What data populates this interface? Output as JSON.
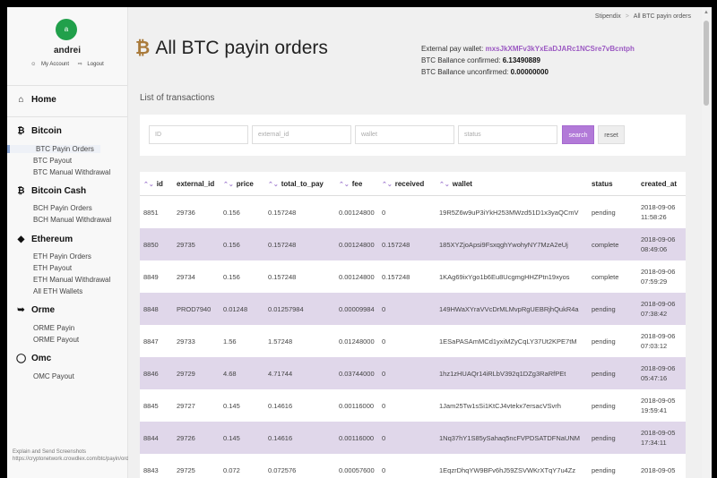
{
  "user": {
    "initial": "a",
    "name": "andrei",
    "my_account": "My Account",
    "logout": "Logout"
  },
  "sidebar": {
    "home": "Home",
    "bitcoin": {
      "title": "Bitcoin",
      "items": [
        "BTC Payin Orders",
        "BTC Payout",
        "BTC Manual Withdrawal"
      ]
    },
    "bitcoin_cash": {
      "title": "Bitcoin Cash",
      "items": [
        "BCH Payin Orders",
        "BCH Manual Withdrawal"
      ]
    },
    "ethereum": {
      "title": "Ethereum",
      "items": [
        "ETH Payin Orders",
        "ETH Payout",
        "ETH Manual Withdrawal",
        "All ETH Wallets"
      ]
    },
    "orme": {
      "title": "Orme",
      "items": [
        "ORME Payin",
        "ORME Payout"
      ]
    },
    "omc": {
      "title": "Omc",
      "items": [
        "OMC Payout"
      ]
    }
  },
  "footer": {
    "explain": "Explain and Send Screenshots",
    "url": "https://cryptonetwork.crowdlex.com/btc/payin/orders"
  },
  "breadcrumb": {
    "root": "Stipendix",
    "current": "All BTC payin orders"
  },
  "page": {
    "title": "All BTC payin orders"
  },
  "info": {
    "wallet_label": "External pay wallet:",
    "wallet_address": "mxsJkXMFv3kYxEaDJARc1NCSre7vBcntph",
    "confirmed_label": "BTC Ballance confirmed:",
    "confirmed_value": "6.13490889",
    "unconfirmed_label": "BTC Ballance unconfirmed:",
    "unconfirmed_value": "0.00000000"
  },
  "filters": {
    "subtitle": "List of transactions",
    "id_placeholder": "ID",
    "external_id_placeholder": "external_id",
    "wallet_placeholder": "wallet",
    "status_placeholder": "status",
    "search_label": "search",
    "reset_label": "reset"
  },
  "table": {
    "headers": {
      "id": "id",
      "external_id": "external_id",
      "price": "price",
      "total_to_pay": "total_to_pay",
      "fee": "fee",
      "received": "received",
      "wallet": "wallet",
      "status": "status",
      "created_at": "created_at"
    },
    "rows": [
      {
        "id": "8851",
        "external_id": "29736",
        "price": "0.156",
        "total_to_pay": "0.157248",
        "fee": "0.00124800",
        "received": "0",
        "wallet": "19R5Z6w9uP3iYkH253MWzd51D1x3yaQCmV",
        "status": "pending",
        "date": "2018-09-06",
        "time": "11:58:26"
      },
      {
        "id": "8850",
        "external_id": "29735",
        "price": "0.156",
        "total_to_pay": "0.157248",
        "fee": "0.00124800",
        "received": "0.157248",
        "wallet": "185XYZjoApsi9FsxqghYwohyNY7MzA2eUj",
        "status": "complete",
        "date": "2018-09-06",
        "time": "08:49:06"
      },
      {
        "id": "8849",
        "external_id": "29734",
        "price": "0.156",
        "total_to_pay": "0.157248",
        "fee": "0.00124800",
        "received": "0.157248",
        "wallet": "1KAg69ixYgo1b6Eu8UcgmgHHZPtn19xyos",
        "status": "complete",
        "date": "2018-09-06",
        "time": "07:59:29"
      },
      {
        "id": "8848",
        "external_id": "PROD7940",
        "price": "0.01248",
        "total_to_pay": "0.01257984",
        "fee": "0.00009984",
        "received": "0",
        "wallet": "149HWaXYraVVcDrMLMvpRgUEBRjhQukR4a",
        "status": "pending",
        "date": "2018-09-06",
        "time": "07:38:42"
      },
      {
        "id": "8847",
        "external_id": "29733",
        "price": "1.56",
        "total_to_pay": "1.57248",
        "fee": "0.01248000",
        "received": "0",
        "wallet": "1ESaPASAmMCd1yxiMZyCqLY37Ut2KPE7tM",
        "status": "pending",
        "date": "2018-09-06",
        "time": "07:03:12"
      },
      {
        "id": "8846",
        "external_id": "29729",
        "price": "4.68",
        "total_to_pay": "4.71744",
        "fee": "0.03744000",
        "received": "0",
        "wallet": "1hz1zHUAQr14iRLbV392q1DZg3RaRfPEt",
        "status": "pending",
        "date": "2018-09-06",
        "time": "05:47:16"
      },
      {
        "id": "8845",
        "external_id": "29727",
        "price": "0.145",
        "total_to_pay": "0.14616",
        "fee": "0.00116000",
        "received": "0",
        "wallet": "1Jam25Tw1sSi1KtCJ4vtekx7ersacVSvrh",
        "status": "pending",
        "date": "2018-09-05",
        "time": "19:59:41"
      },
      {
        "id": "8844",
        "external_id": "29726",
        "price": "0.145",
        "total_to_pay": "0.14616",
        "fee": "0.00116000",
        "received": "0",
        "wallet": "1Nq37hY1S85ySahaq5ncFVPDSATDFNaUNM",
        "status": "pending",
        "date": "2018-09-05",
        "time": "17:34:11"
      },
      {
        "id": "8843",
        "external_id": "29725",
        "price": "0.072",
        "total_to_pay": "0.072576",
        "fee": "0.00057600",
        "received": "0",
        "wallet": "1EqzrDhqYW9BFv6hJ59ZSVWKrXTqY7u4Zz",
        "status": "pending",
        "date": "2018-09-05",
        "time": ""
      }
    ]
  },
  "colors": {
    "accent": "#b27ad8",
    "row_alt": "#e0d7ea",
    "avatar": "#21a04b",
    "bitcoin_icon": "#a97a3a"
  }
}
